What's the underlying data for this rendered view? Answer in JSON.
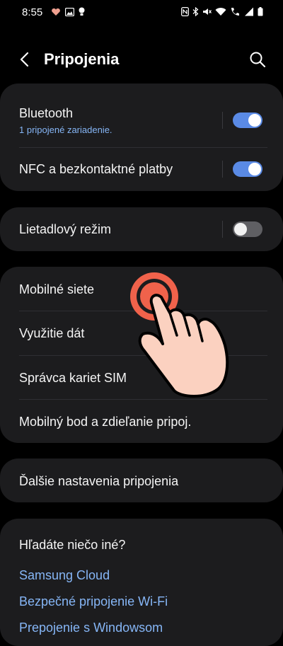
{
  "status": {
    "time": "8:55",
    "left_icons": [
      "heart-icon",
      "image-icon",
      "bulb-icon"
    ],
    "right_icons": [
      "nfc-icon",
      "bluetooth-icon",
      "mute-icon",
      "wifi-icon",
      "call-icon",
      "signal-icon",
      "battery-icon"
    ]
  },
  "header": {
    "title": "Pripojenia"
  },
  "connections": {
    "bluetooth": {
      "label": "Bluetooth",
      "subtitle": "1 pripojené zariadenie.",
      "enabled": true
    },
    "nfc": {
      "label": "NFC a bezkontaktné platby",
      "enabled": true
    },
    "airplane": {
      "label": "Lietadlový režim",
      "enabled": false
    }
  },
  "network": {
    "items": [
      {
        "label": "Mobilné siete"
      },
      {
        "label": "Využitie dát"
      },
      {
        "label": "Správca kariet SIM"
      },
      {
        "label": "Mobilný bod a zdieľanie pripoj."
      }
    ]
  },
  "more": {
    "label": "Ďalšie nastavenia pripojenia"
  },
  "suggestions": {
    "title": "Hľadáte niečo iné?",
    "links": [
      "Samsung Cloud",
      "Bezpečné pripojenie Wi-Fi",
      "Prepojenie s Windowsom"
    ]
  },
  "colors": {
    "accent": "#5a8ae5",
    "link": "#86b6f6",
    "card": "#1c1c1e",
    "tap_indicator": "#f0624b",
    "hand_fill": "#fbd1c0"
  }
}
